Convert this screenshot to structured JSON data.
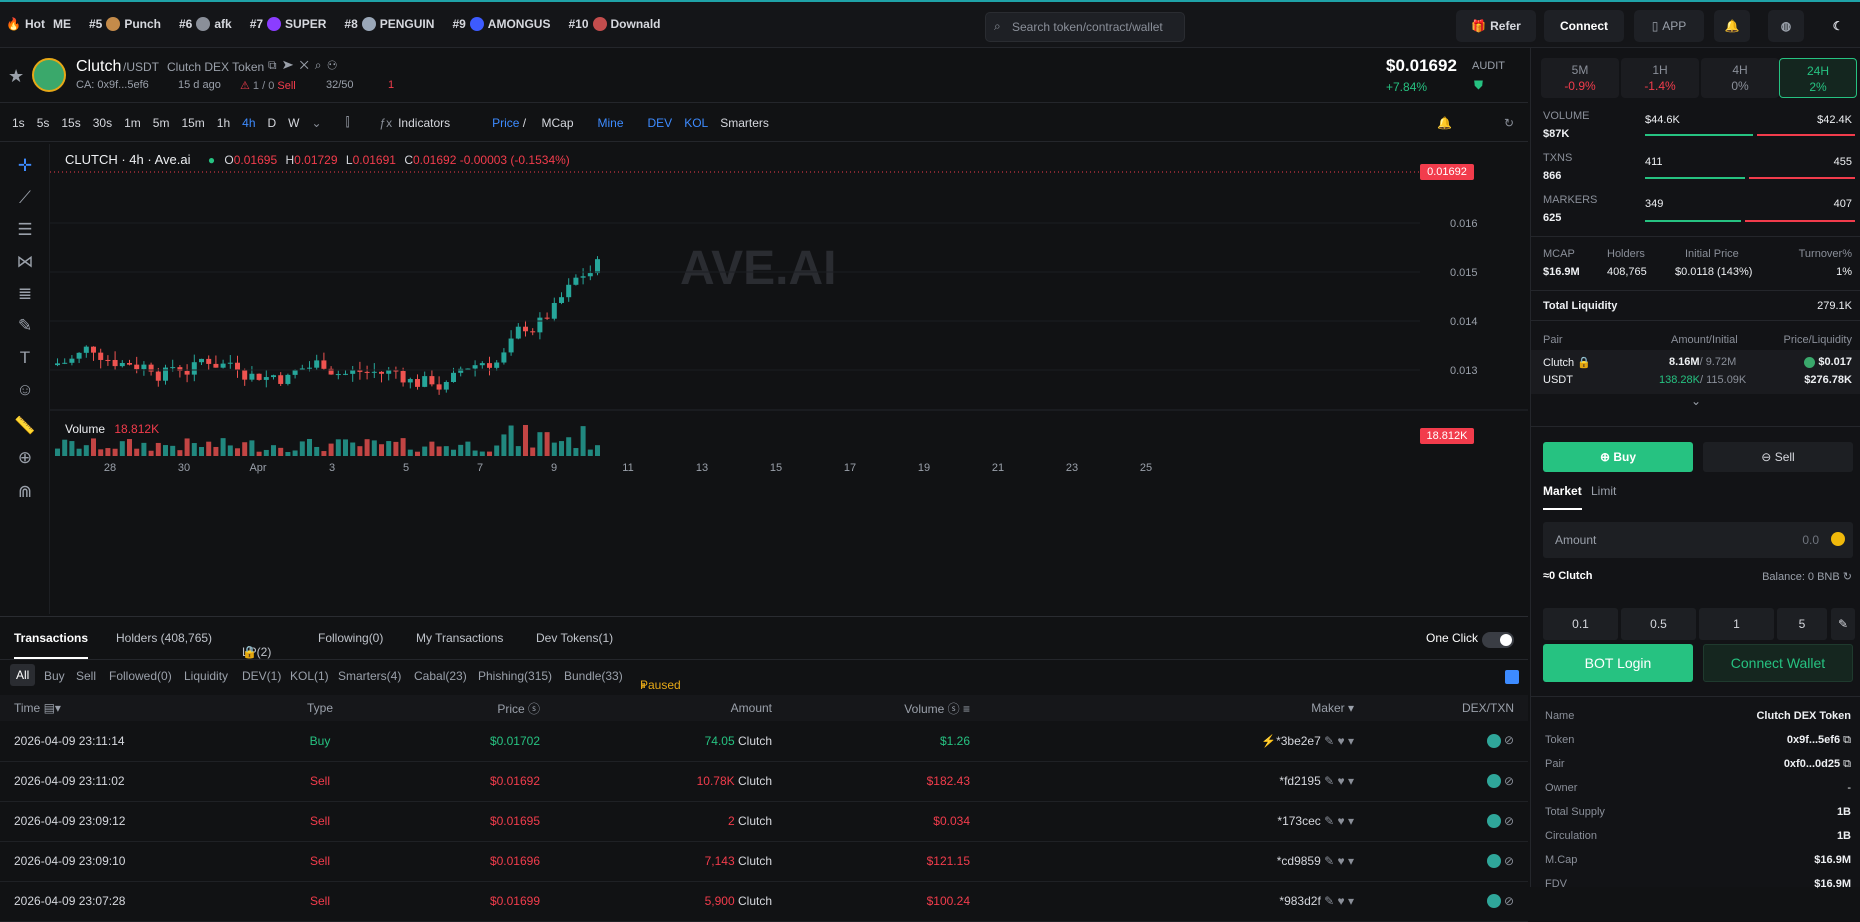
{
  "topbar": {
    "hot_label": "Hot",
    "items": [
      {
        "rank": "ME",
        "label": "",
        "color": "#e35b3b"
      },
      {
        "rank": "#5",
        "label": "Punch",
        "color": "#c48b4a"
      },
      {
        "rank": "#6",
        "label": "afk",
        "color": "#8a8f99"
      },
      {
        "rank": "#7",
        "label": "SUPER",
        "color": "#8b3dff"
      },
      {
        "rank": "#8",
        "label": "PENGUIN",
        "color": "#9aa7b8"
      },
      {
        "rank": "#9",
        "label": "AMONGUS",
        "color": "#3d5bff"
      },
      {
        "rank": "#10",
        "label": "Downald",
        "color": "#c34d4d"
      }
    ],
    "search_placeholder": "Search token/contract/wallet",
    "refer": "Refer",
    "connect": "Connect",
    "app": "APP"
  },
  "token": {
    "name": "Clutch",
    "pair": "/USDT",
    "full": "Clutch DEX Token",
    "ca": "CA: 0x9f...5ef6",
    "age": "15 d ago",
    "sell_tag": "1 / 0",
    "sell_word": "Sell",
    "holders_tag": "32/50",
    "alerts": "1",
    "price": "$0.01692",
    "change": "+7.84%",
    "audit": "AUDIT"
  },
  "toolbar": {
    "intervals": [
      "1s",
      "5s",
      "15s",
      "30s",
      "1m",
      "5m",
      "15m",
      "1h",
      "4h",
      "D",
      "W"
    ],
    "active": "4h",
    "indicators": "Indicators",
    "price": "Price",
    "mcap": "MCap",
    "mine": "Mine",
    "dev": "DEV",
    "kol": "KOL",
    "smarters": "Smarters"
  },
  "legend": {
    "title": "CLUTCH · 4h · Ave.ai",
    "o_label": "O",
    "o": "0.01695",
    "h_label": "H",
    "h": "0.01729",
    "l_label": "L",
    "l": "0.01691",
    "c_label": "C",
    "c": "0.01692",
    "chg": "-0.00003 (-0.1534%)",
    "watermark": "AVE.AI",
    "vol_label": "Volume",
    "vol": "18.812K",
    "vol_tag": "18.812K",
    "price_tag": "0.01692"
  },
  "chart_data": {
    "type": "candlestick",
    "yticks": [
      "0.016",
      "0.015",
      "0.014",
      "0.013"
    ],
    "xticks": [
      "28",
      "30",
      "Apr",
      "3",
      "5",
      "7",
      "9",
      "11",
      "13",
      "15",
      "17",
      "19",
      "21",
      "23",
      "25"
    ],
    "last_price": 0.01692
  },
  "tabs": {
    "items": [
      "Transactions",
      "Holders (408,765)",
      "LP(2)",
      "Following(0)",
      "My Transactions",
      "Dev Tokens(1)"
    ],
    "one_click": "One Click"
  },
  "filters": {
    "items": [
      "All",
      "Buy",
      "Sell",
      "Followed(0)",
      "Liquidity",
      "DEV(1)",
      "KOL(1)",
      "Smarters(4)",
      "Cabal(23)",
      "Phishing(315)",
      "Bundle(33)"
    ],
    "paused": "Paused"
  },
  "table": {
    "headers": [
      "Time",
      "Type",
      "Price",
      "Amount",
      "Volume",
      "Maker",
      "DEX/TXN"
    ],
    "rows": [
      {
        "time": "2026-04-09 23:11:14",
        "type": "Buy",
        "price": "$0.01702",
        "amount": "74.05",
        "unit": "Clutch",
        "volume": "$1.26",
        "maker": "*3be2e7"
      },
      {
        "time": "2026-04-09 23:11:02",
        "type": "Sell",
        "price": "$0.01692",
        "amount": "10.78K",
        "unit": "Clutch",
        "volume": "$182.43",
        "maker": "*fd2195"
      },
      {
        "time": "2026-04-09 23:09:12",
        "type": "Sell",
        "price": "$0.01695",
        "amount": "2",
        "unit": "Clutch",
        "volume": "$0.034",
        "maker": "*173cec"
      },
      {
        "time": "2026-04-09 23:09:10",
        "type": "Sell",
        "price": "$0.01696",
        "amount": "7,143",
        "unit": "Clutch",
        "volume": "$121.15",
        "maker": "*cd9859"
      },
      {
        "time": "2026-04-09 23:07:28",
        "type": "Sell",
        "price": "$0.01699",
        "amount": "5,900",
        "unit": "Clutch",
        "volume": "$100.24",
        "maker": "*983d2f"
      }
    ]
  },
  "periods": [
    {
      "label": "5M",
      "val": "-0.9%"
    },
    {
      "label": "1H",
      "val": "-1.4%"
    },
    {
      "label": "4H",
      "val": "0%"
    },
    {
      "label": "24H",
      "val": "2%"
    }
  ],
  "stats": {
    "volume_label": "VOLUME",
    "volume": "$87K",
    "vol_buy": "$44.6K",
    "vol_sell": "$42.4K",
    "txns_label": "TXNS",
    "txns": "866",
    "txn_buy": "411",
    "txn_sell": "455",
    "makers_label": "MARKERS",
    "makers": "625",
    "mk_buy": "349",
    "mk_sell": "407"
  },
  "metrics": {
    "mcap_label": "MCAP",
    "mcap": "$16.9M",
    "holders_label": "Holders",
    "holders": "408,765",
    "init_label": "Initial Price",
    "init": "$0.0118 (143%)",
    "turn_label": "Turnover%",
    "turn": "1%",
    "liq_label": "Total Liquidity",
    "liq": "279.1K"
  },
  "pair": {
    "h1": "Pair",
    "h2": "Amount/Initial",
    "h3": "Price/Liquidity",
    "t1": "Clutch",
    "t2": "USDT",
    "a1": "8.16M",
    "a1i": "/ 9.72M",
    "a2": "138.28K",
    "a2i": "/ 115.09K",
    "p1": "$0.017",
    "p2": "$276.78K"
  },
  "trade": {
    "buy": "Buy",
    "sell": "Sell",
    "market": "Market",
    "limit": "Limit",
    "amount": "Amount",
    "amount_val": "0.0",
    "approx": "≈0 Clutch",
    "balance": "Balance: 0 BNB",
    "quick": [
      "0.1",
      "0.5",
      "1",
      "5"
    ],
    "bot": "BOT Login",
    "wallet": "Connect Wallet"
  },
  "info": [
    {
      "k": "Name",
      "v": "Clutch DEX Token"
    },
    {
      "k": "Token",
      "v": "0x9f...5ef6"
    },
    {
      "k": "Pair",
      "v": "0xf0...0d25"
    },
    {
      "k": "Owner",
      "v": "-"
    },
    {
      "k": "Total Supply",
      "v": "1B"
    },
    {
      "k": "Circulation",
      "v": "1B"
    },
    {
      "k": "M.Cap",
      "v": "$16.9M"
    },
    {
      "k": "FDV",
      "v": "$16.9M"
    }
  ]
}
